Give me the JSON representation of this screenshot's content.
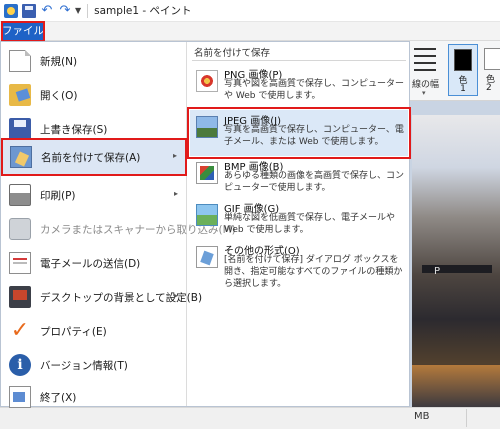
{
  "window": {
    "title": "sample1 - ペイント"
  },
  "file_tab": {
    "label": "ファイル"
  },
  "ribbon": {
    "line_width_label": "線の幅",
    "color1_label": "色\n1",
    "color1_name": "色",
    "color1_index": "1",
    "color2_name": "色",
    "color2_index": "2"
  },
  "canvas": {
    "overlay_text": "P"
  },
  "status": {
    "size_text": "MB"
  },
  "file_menu": {
    "items": [
      {
        "label": "新規(N)",
        "icon": "new-file-icon"
      },
      {
        "label": "開く(O)",
        "icon": "open-folder-icon"
      },
      {
        "label": "上書き保存(S)",
        "icon": "save-icon"
      },
      {
        "label": "名前を付けて保存(A)",
        "icon": "save-as-icon",
        "has_submenu": "▸"
      },
      {
        "label": "印刷(P)",
        "icon": "printer-icon",
        "has_submenu": "▸"
      },
      {
        "label": "カメラまたはスキャナーから取り込み(M)",
        "icon": "scanner-icon"
      },
      {
        "label": "電子メールの送信(D)",
        "icon": "mail-icon"
      },
      {
        "label": "デスクトップの背景として設定(B)",
        "icon": "desktop-icon",
        "has_submenu": "▸"
      },
      {
        "label": "プロパティ(E)",
        "icon": "checkmark-icon"
      },
      {
        "label": "バージョン情報(T)",
        "icon": "info-icon"
      },
      {
        "label": "終了(X)",
        "icon": "exit-icon"
      }
    ]
  },
  "save_as_menu": {
    "title": "名前を付けて保存",
    "items": [
      {
        "title": "PNG 画像(P)",
        "desc": "写真や図を高画質で保存し、コンピューターや Web で使用します。"
      },
      {
        "title": "JPEG 画像(J)",
        "desc": "写真を高画質で保存し、コンピューター、電子メール、または Web で使用します。"
      },
      {
        "title": "BMP 画像(B)",
        "desc": "あらゆる種類の画像を高画質で保存し、コンピューターで使用します。"
      },
      {
        "title": "GIF 画像(G)",
        "desc": "単純な図を低画質で保存し、電子メールや Web で使用します。"
      },
      {
        "title": "その他の形式(O)",
        "desc": "[名前を付けて保存] ダイアログ ボックスを開き、指定可能なすべてのファイルの種類から選択します。"
      }
    ]
  },
  "colors": {
    "accent": "#1e62c6",
    "highlight_outline": "#e11a1a",
    "hover_bg": "#dce6f4"
  }
}
